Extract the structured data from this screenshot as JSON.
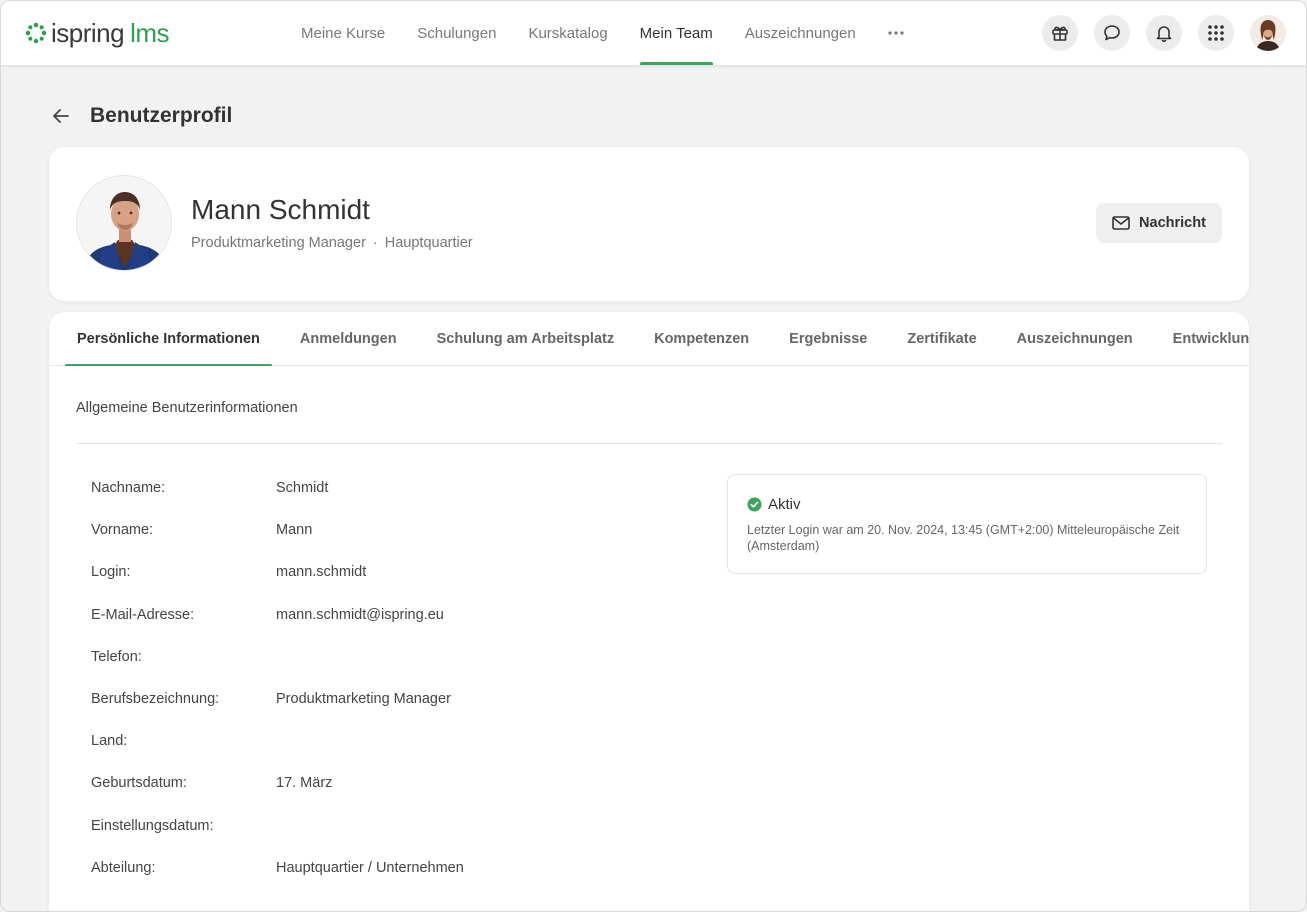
{
  "app": {
    "logo_main": "ispring",
    "logo_accent": "lms",
    "accent_color": "#3aa55c"
  },
  "nav": {
    "items": [
      {
        "label": "Meine Kurse"
      },
      {
        "label": "Schulungen"
      },
      {
        "label": "Kurskatalog"
      },
      {
        "label": "Mein Team",
        "active": true
      },
      {
        "label": "Auszeichnungen"
      }
    ],
    "more_icon": "more-horizontal-icon"
  },
  "header_icons": [
    "gift-icon",
    "chat-icon",
    "bell-icon",
    "apps-grid-icon",
    "avatar"
  ],
  "page": {
    "title": "Benutzerprofil",
    "back_icon": "arrow-left-icon"
  },
  "profile": {
    "name": "Mann Schmidt",
    "job_title": "Produktmarketing Manager",
    "separator": "·",
    "department": "Hauptquartier",
    "message_button": "Nachricht"
  },
  "tabs": [
    {
      "label": "Persönliche Informationen",
      "active": true
    },
    {
      "label": "Anmeldungen"
    },
    {
      "label": "Schulung am Arbeitsplatz"
    },
    {
      "label": "Kompetenzen"
    },
    {
      "label": "Ergebnisse"
    },
    {
      "label": "Zertifikate"
    },
    {
      "label": "Auszeichnungen"
    },
    {
      "label": "Entwicklungspläne"
    }
  ],
  "section": {
    "title": "Allgemeine Benutzerinformationen"
  },
  "fields": [
    {
      "label": "Nachname:",
      "value": "Schmidt"
    },
    {
      "label": "Vorname:",
      "value": "Mann"
    },
    {
      "label": "Login:",
      "value": "mann.schmidt"
    },
    {
      "label": "E-Mail-Adresse:",
      "value": "mann.schmidt@ispring.eu"
    },
    {
      "label": "Telefon:",
      "value": ""
    },
    {
      "label": "Berufsbezeichnung:",
      "value": "Produktmarketing Manager"
    },
    {
      "label": "Land:",
      "value": ""
    },
    {
      "label": "Geburtsdatum:",
      "value": "17. März"
    },
    {
      "label": "Einstellungsdatum:",
      "value": ""
    },
    {
      "label": "Abteilung:",
      "value": "Hauptquartier / Unternehmen"
    }
  ],
  "status": {
    "label": "Aktiv",
    "color": "#3aa55c",
    "last_login": "Letzter Login war am 20. Nov. 2024, 13:45 (GMT+2:00) Mitteleuropäische Zeit (Amsterdam)"
  }
}
